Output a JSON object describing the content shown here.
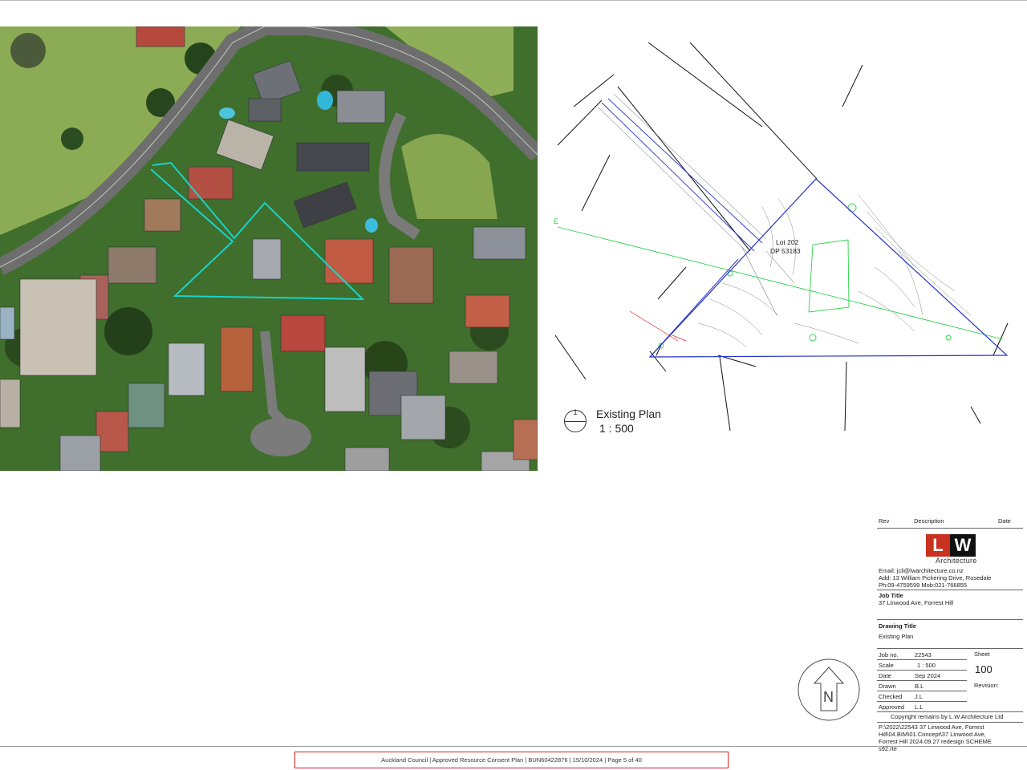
{
  "plan": {
    "view_number": "1",
    "view_name": "Existing Plan",
    "view_scale": "1 : 500",
    "lot_label": "Lot 202",
    "dp_label": "DP 53183",
    "edge_marker": "E"
  },
  "north_arrow": {
    "letter": "N"
  },
  "title_block": {
    "rev_header": "Rev",
    "description_header": "Description",
    "date_header": "Date",
    "logo_l": "L",
    "logo_w": "W",
    "logo_subtitle": "Architecture",
    "email": "Email: jcli@lwarchitecture.co.nz",
    "address": "Add: 13 William Pickering Drive, Rosedale",
    "phone": "Ph:09-4759599 Mob:021-766855",
    "job_title_label": "Job Title",
    "job_title": "37 Linwood Ave, Forrest Hill",
    "drawing_title_label": "Drawing Title",
    "drawing_title": "Existing Plan",
    "job_no_label": "Job no.",
    "job_no": "22543",
    "sheet_label": "Sheet",
    "sheet": "100",
    "scale_label": "Scale",
    "scale": "1 : 500",
    "date_label": "Date",
    "date": "Sep 2024",
    "revision_label": "Revision:",
    "drawn_label": "Drawn",
    "drawn": "B.L",
    "checked_label": "Checked",
    "checked": "J.L",
    "approved_label": "Approved",
    "approved": "L.L",
    "copyright": "Copyright remains by L.W Architecture Ltd",
    "path_line1": "P:\\2022\\22543 37 Linwood Ave, Forrest",
    "path_line2": "Hill\\04.BIM\\01.Concept\\37 Linwood Ave,",
    "path_line3": "Forrest Hill 2024.09.27 redesign SCHEME",
    "path_line4": "s92.rte"
  },
  "footer": {
    "stamp": "Auckland Council  |  Approved Resource Consent Plan  |  BUN60422876  |  15/10/2024  |  Page 5 of 40"
  },
  "colors": {
    "boundary_cyan": "#19d3c9",
    "plan_blue": "#2733c7",
    "plan_green": "#2bd24a",
    "stamp_red": "#dd2222",
    "logo_red": "#c8321e"
  }
}
